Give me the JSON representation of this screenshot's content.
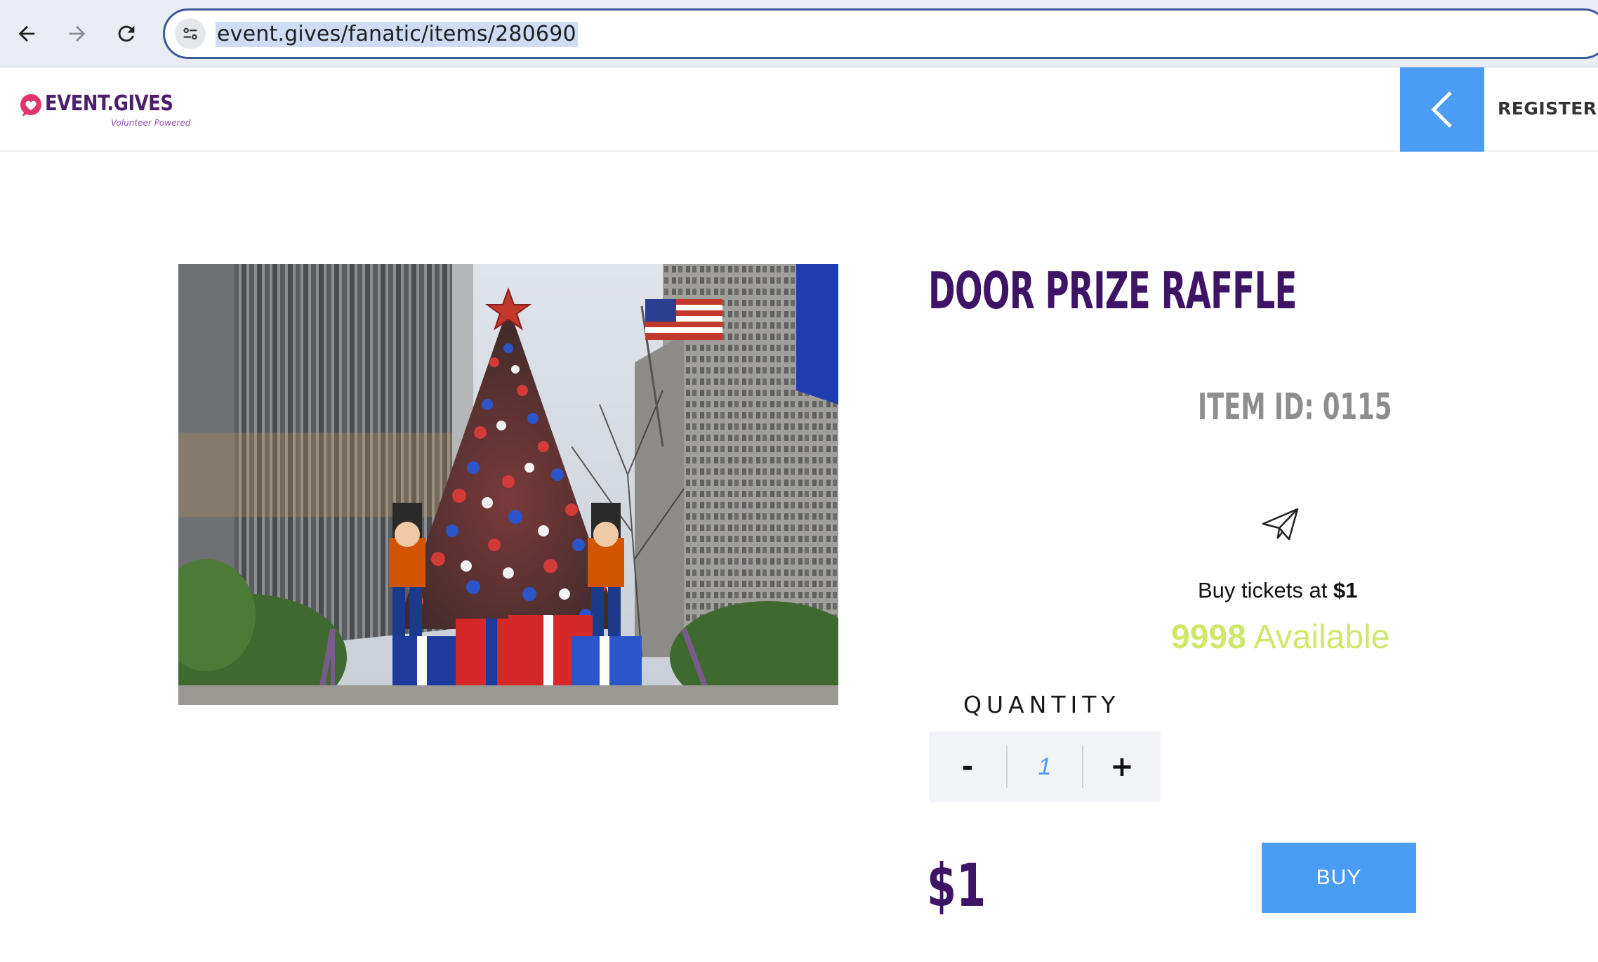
{
  "browser": {
    "url": "event.gives/fanatic/items/280690",
    "icons": {
      "back": "arrow-left-icon",
      "forward": "arrow-right-icon",
      "reload": "reload-icon",
      "site_info": "tune-icon"
    }
  },
  "header": {
    "logo_text": "EVENT.GIVES",
    "logo_tagline": "Volunteer Powered",
    "register_label": "REGISTER",
    "back_icon": "chevron-left-icon"
  },
  "item": {
    "title": "DOOR PRIZE RAFFLE",
    "item_id_label": "ITEM ID: 0115",
    "buy_tickets_prefix": "Buy tickets at ",
    "ticket_price": "$1",
    "available_count": "9998",
    "available_label": " Available",
    "quantity_label": "QUANTITY",
    "quantity_value": "1",
    "minus_label": "-",
    "plus_label": "+",
    "price": "$1",
    "buy_label": "BUY",
    "image_alt": "Christmas tree with ornaments between tall office buildings"
  },
  "colors": {
    "brand_purple": "#3e1566",
    "accent_blue": "#4a9cf4",
    "available_green": "#cfe86a",
    "logo_pink": "#e0356a"
  }
}
